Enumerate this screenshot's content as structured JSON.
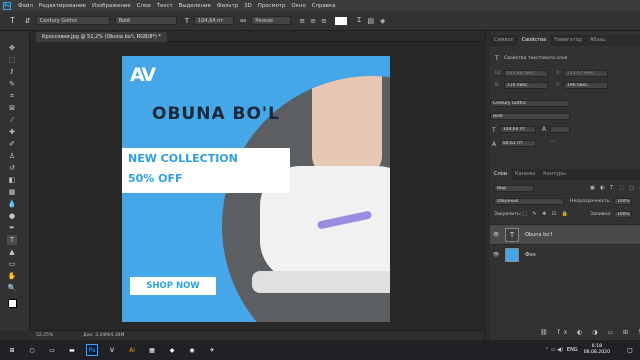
{
  "menubar": {
    "app_icon": "Ps",
    "items": [
      "Файл",
      "Редактирование",
      "Изображение",
      "Слои",
      "Текст",
      "Выделение",
      "Фильтр",
      "3D",
      "Просмотр",
      "Окно",
      "Справка"
    ]
  },
  "options": {
    "font_family": "Century Gothic",
    "font_style": "Bold",
    "font_size": "104,64 пт",
    "antialias": "Резкое"
  },
  "document_tab": {
    "title": "Кроссовки.jpg @ 52,2% (Obuna bo'l, RGB/8*) *"
  },
  "canvas": {
    "logo": "AV",
    "brand": "OBUNA BO'L",
    "collection": "NEW COLLECTION",
    "discount": "50% OFF",
    "shop_button": "SHOP NOW",
    "bg_color": "#45a6e8",
    "accent_color": "#2e9fe6"
  },
  "statusbar": {
    "zoom": "52,25%",
    "doc_info": "Док: 3,34M/4,34M"
  },
  "properties_panel": {
    "tabs": [
      "Символ",
      "Свойства",
      "Навигатор",
      "Абзац"
    ],
    "active_tab": "Свойства",
    "section_title": "Свойства текстового слоя",
    "w_label": "Ш:",
    "w_value": "623,88 пикс.",
    "x_label": "X:",
    "x_value": "113,67 пикс.",
    "h_label": "В:",
    "h_value": "116 пикс.",
    "y_label": "Y:",
    "y_value": "196 пикс.",
    "font_family": "Century Gothic",
    "font_style": "Bold",
    "font_size": "104,64 пт",
    "leading": "80,61 пт"
  },
  "layers_panel": {
    "tabs": [
      "Слои",
      "Каналы",
      "Контуры"
    ],
    "active_tab": "Слои",
    "kind_filter": "Вид",
    "blend_mode": "Обычные",
    "opacity_label": "Непрозрачность:",
    "opacity_value": "100%",
    "lock_label": "Закрепить:",
    "fill_label": "Заливка:",
    "fill_value": "100%",
    "layers": [
      {
        "name": "Obuna bo'l",
        "type": "T"
      },
      {
        "name": "Фон",
        "type": "image"
      }
    ]
  },
  "taskbar": {
    "lang": "ENG",
    "time": "6:18",
    "date": "08.08.2020"
  }
}
